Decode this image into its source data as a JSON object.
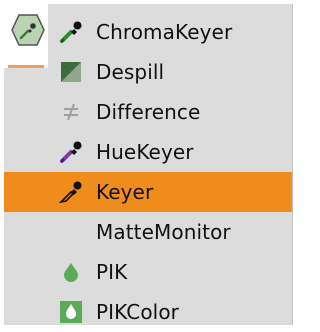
{
  "menu": {
    "items": [
      {
        "label": "ChromaKeyer",
        "icon": "eyedropper-green-icon"
      },
      {
        "label": "Despill",
        "icon": "despill-triangle-icon"
      },
      {
        "label": "Difference",
        "icon": "not-equal-icon"
      },
      {
        "label": "HueKeyer",
        "icon": "eyedropper-purple-icon"
      },
      {
        "label": "Keyer",
        "icon": "eyedropper-outline-icon",
        "selected": true
      },
      {
        "label": "MatteMonitor",
        "icon": ""
      },
      {
        "label": "PIK",
        "icon": "green-drop-icon"
      },
      {
        "label": "PIKColor",
        "icon": "green-square-drop-icon"
      }
    ]
  },
  "colors": {
    "selected_bg": "#f08c1c",
    "panel_bg": "#dcdcdc",
    "underline": "#f0a05a"
  }
}
